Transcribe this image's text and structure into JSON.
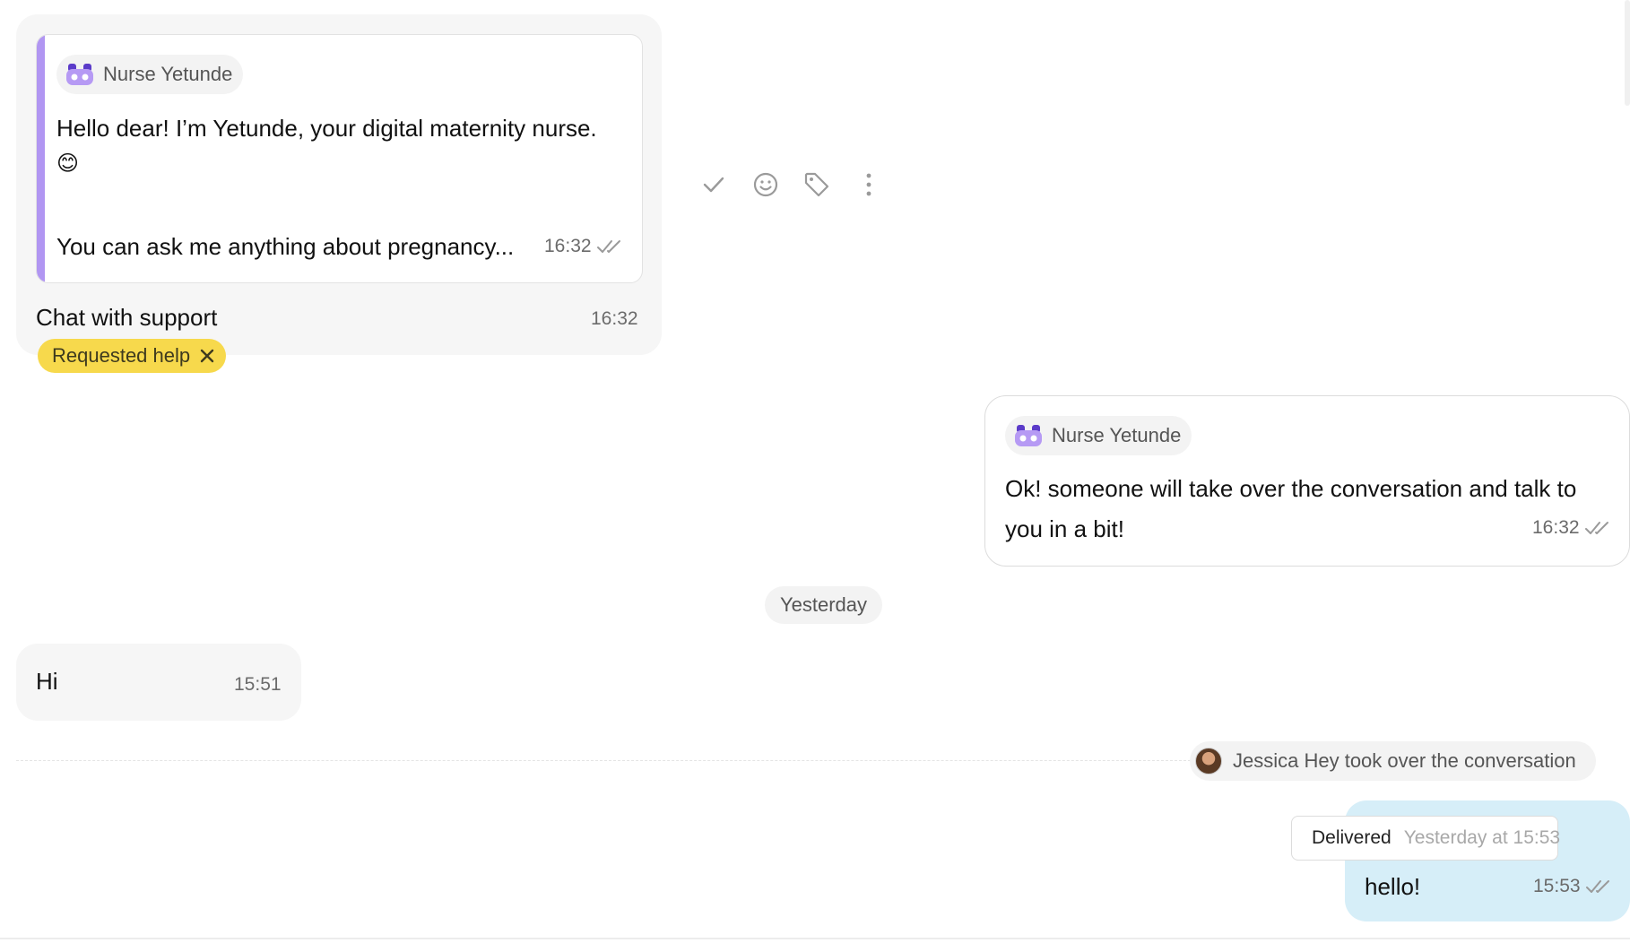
{
  "messages": {
    "welcome": {
      "quote": {
        "sender": "Nurse Yetunde",
        "line1": "Hello dear! I’m Yetunde, your digital maternity nurse.",
        "emoji": "😊",
        "line2": "You can ask me anything about pregnancy...",
        "time": "16:32"
      },
      "caption": "Chat with support",
      "time": "16:32",
      "tag": "Requested help"
    },
    "bot_reply": {
      "sender": "Nurse Yetunde",
      "line1": "Ok! someone will take over the conversation and talk to",
      "line2": "you in a bit!",
      "time": "16:32"
    },
    "date_separator": "Yesterday",
    "user_hi": {
      "text": "Hi",
      "time": "15:51"
    },
    "takeover": {
      "text": "Jessica Hey took over the conversation"
    },
    "agent_hello": {
      "text": "hello!",
      "time": "15:53",
      "status_label": "Delivered",
      "status_time": "Yesterday at 15:53"
    }
  },
  "toolbar": {
    "icons": [
      "check-icon",
      "emoji-icon",
      "tag-icon",
      "more-icon"
    ]
  },
  "colors": {
    "incoming_bg": "#f6f6f6",
    "outgoing_blue": "#d6eef8",
    "accent_purple": "#b196f2",
    "tag_yellow": "#f7d94c"
  }
}
